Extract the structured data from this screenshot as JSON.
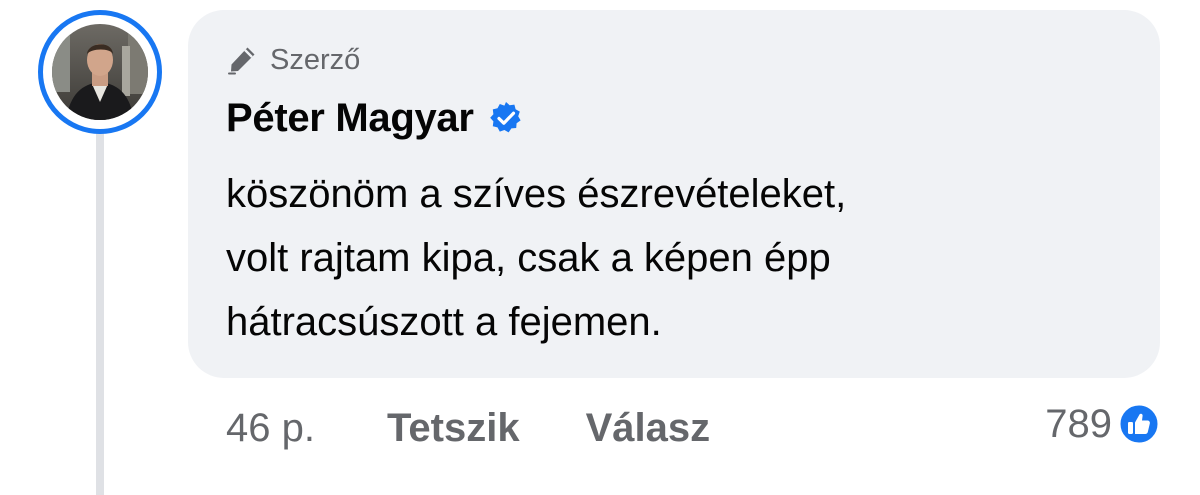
{
  "comment": {
    "author_badge_label": "Szerző",
    "author_badge_icon": "pencil-icon",
    "author_name": "Péter Magyar",
    "verified_icon": "verified-badge-icon",
    "text_lines": [
      "köszönöm a szíves észrevételeket,",
      "volt rajtam kipa, csak a képen épp",
      "hátracsúszott a fejemen."
    ],
    "time": "46 p.",
    "like_action": "Tetszik",
    "reply_action": "Válasz",
    "reaction_count": "789",
    "reaction_icon": "like-thumbs-up-icon"
  },
  "colors": {
    "accent": "#1877f2",
    "bubble": "#f0f2f5",
    "secondary_text": "#65676b",
    "primary_text": "#050505",
    "thread_line": "#dfe1e5"
  }
}
